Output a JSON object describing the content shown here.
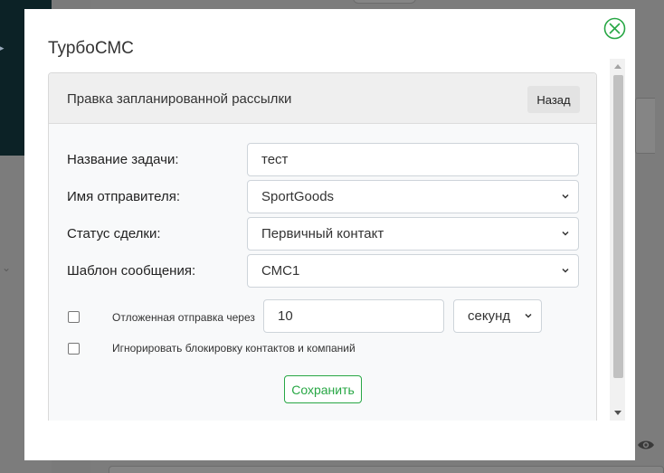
{
  "modal": {
    "title": "ТурбоСМС",
    "close_icon": "close-circle-icon",
    "accent_color": "#28a745"
  },
  "card": {
    "header_title": "Правка запланированной рассылки",
    "back_label": "Назад"
  },
  "form": {
    "task_name": {
      "label": "Название задачи:",
      "value": "тест"
    },
    "sender_name": {
      "label": "Имя отправителя:",
      "value": "SportGoods"
    },
    "deal_status": {
      "label": "Статус сделки:",
      "value": "Первичный контакт"
    },
    "message_template": {
      "label": "Шаблон сообщения:",
      "value": "СМС1"
    },
    "delayed_send": {
      "label": "Отложенная отправка через",
      "value": "10",
      "unit": "секунд",
      "checked": false
    },
    "ignore_block": {
      "label": "Игнорировать блокировку контактов и компаний",
      "checked": false
    }
  },
  "actions": {
    "save_label": "Сохранить"
  }
}
